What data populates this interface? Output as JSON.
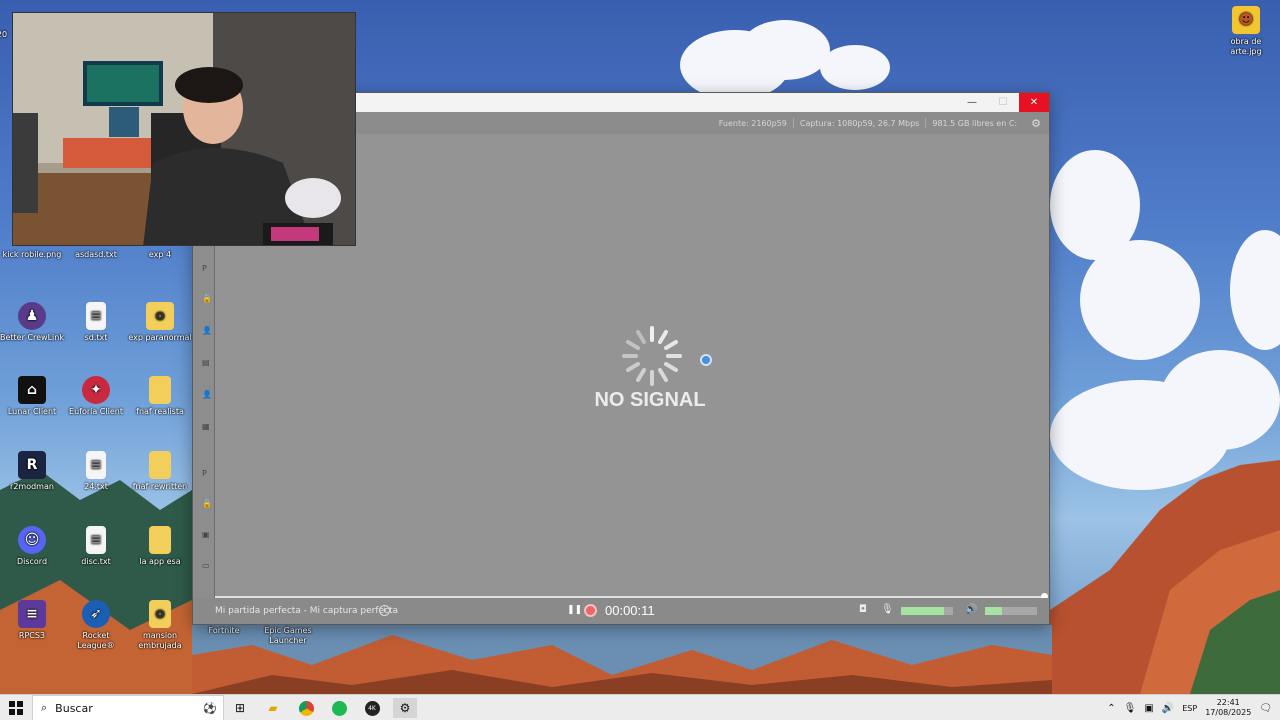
{
  "app_window": {
    "status": {
      "fuente": "Fuente: 2160p59",
      "captura": "Captura: 1080p59, 26.7 Mbps",
      "storage": "981.5 GB libres en C:"
    },
    "preview": {
      "message": "NO SIGNAL"
    },
    "controls": {
      "title": "Mi partida perfecta - Mi captura perfecta",
      "time": "00:00:11"
    },
    "left_strip_letters": [
      "P",
      "P"
    ]
  },
  "desktop_icons": {
    "obra_de_arte": "obra de arte.jpg",
    "kick_robile": "kick robile.png",
    "asdasd": "asdasd.txt",
    "exp4": "exp 4",
    "better_crewlink": "Better CrewLink",
    "sd": "sd.txt",
    "exp_paranormal": "exp paranormal",
    "lunar_client": "Lunar Client",
    "euforia_client": "Euforia Client",
    "fnaf_realista": "fnaf realista",
    "r2modman": "r2modman",
    "file24": "24.txt",
    "fnaf_rewritten": "fnaf rewritten",
    "discord": "Discord",
    "disc": "disc.txt",
    "la_app_esa": "la app esa",
    "rpcs3": "RPCS3",
    "rocket_league": "Rocket League®",
    "mansion": "mansion embrujada",
    "fortnite": "Fortnite",
    "epic": "Epic Games Launcher",
    "top_left_partial": "20"
  },
  "taskbar": {
    "search_placeholder": "Buscar",
    "lang": "ESP",
    "time": "22:41",
    "date": "17/08/2025"
  },
  "colors": {
    "close_red": "#e81123",
    "record_red": "#e66666",
    "meter_green": "#a6e3a3"
  }
}
